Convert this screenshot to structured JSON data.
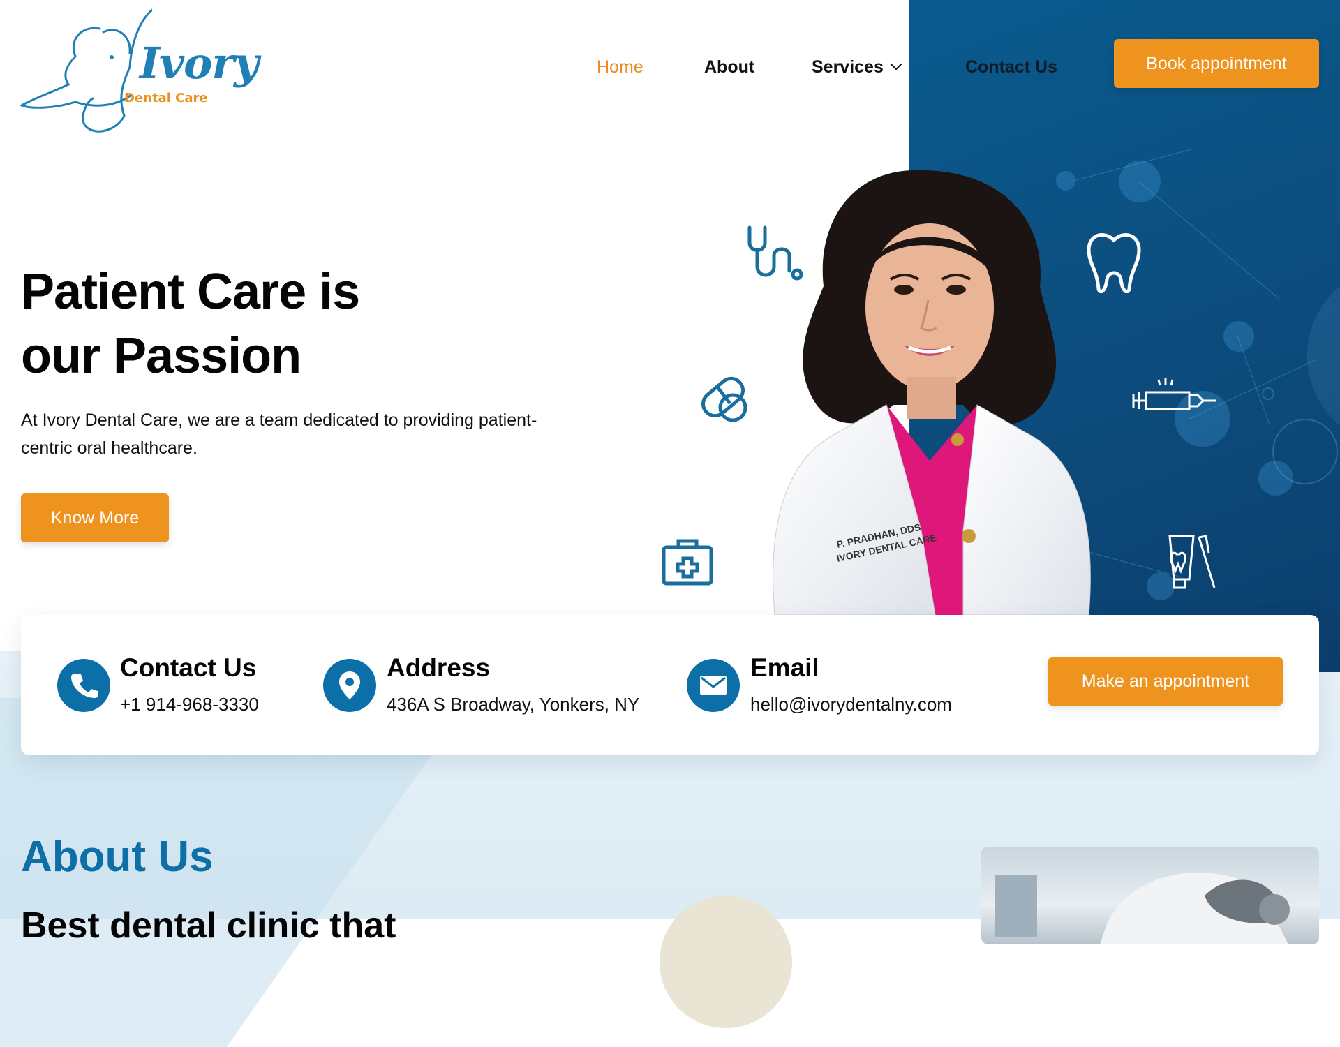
{
  "brand": {
    "logo_main": "Ivory",
    "logo_sub": "Dental Care"
  },
  "nav": {
    "home": "Home",
    "about": "About",
    "services": "Services",
    "contact": "Contact Us",
    "book_button": "Book appointment"
  },
  "hero": {
    "title_line1": "Patient Care is",
    "title_line2": "our Passion",
    "subtitle": "At Ivory Dental Care, we are a team dedicated to providing patient-centric oral healthcare.",
    "cta": "Know More",
    "badge_line1": "P. PRADHAN, DDS",
    "badge_line2": "IVORY DENTAL CARE"
  },
  "contact_card": {
    "phone_title": "Contact Us",
    "phone_value": "+1 914-968-3330",
    "address_title": "Address",
    "address_value": "436A S Broadway, Yonkers, NY",
    "email_title": "Email",
    "email_value": "hello@ivorydentalny.com",
    "appointment_button": "Make an appointment"
  },
  "about": {
    "title": "About Us",
    "subtitle": "Best dental clinic that"
  },
  "colors": {
    "accent_orange": "#ef931f",
    "brand_blue": "#0d6fa8",
    "panel_blue": "#0b4f80"
  },
  "icons": {
    "phone": "phone-icon",
    "address": "map-pin-icon",
    "email": "envelope-icon",
    "hero_decor": [
      "stethoscope-icon",
      "pill-icon",
      "first-aid-kit-icon",
      "tooth-icon",
      "syringe-icon",
      "toothpaste-icon"
    ]
  }
}
